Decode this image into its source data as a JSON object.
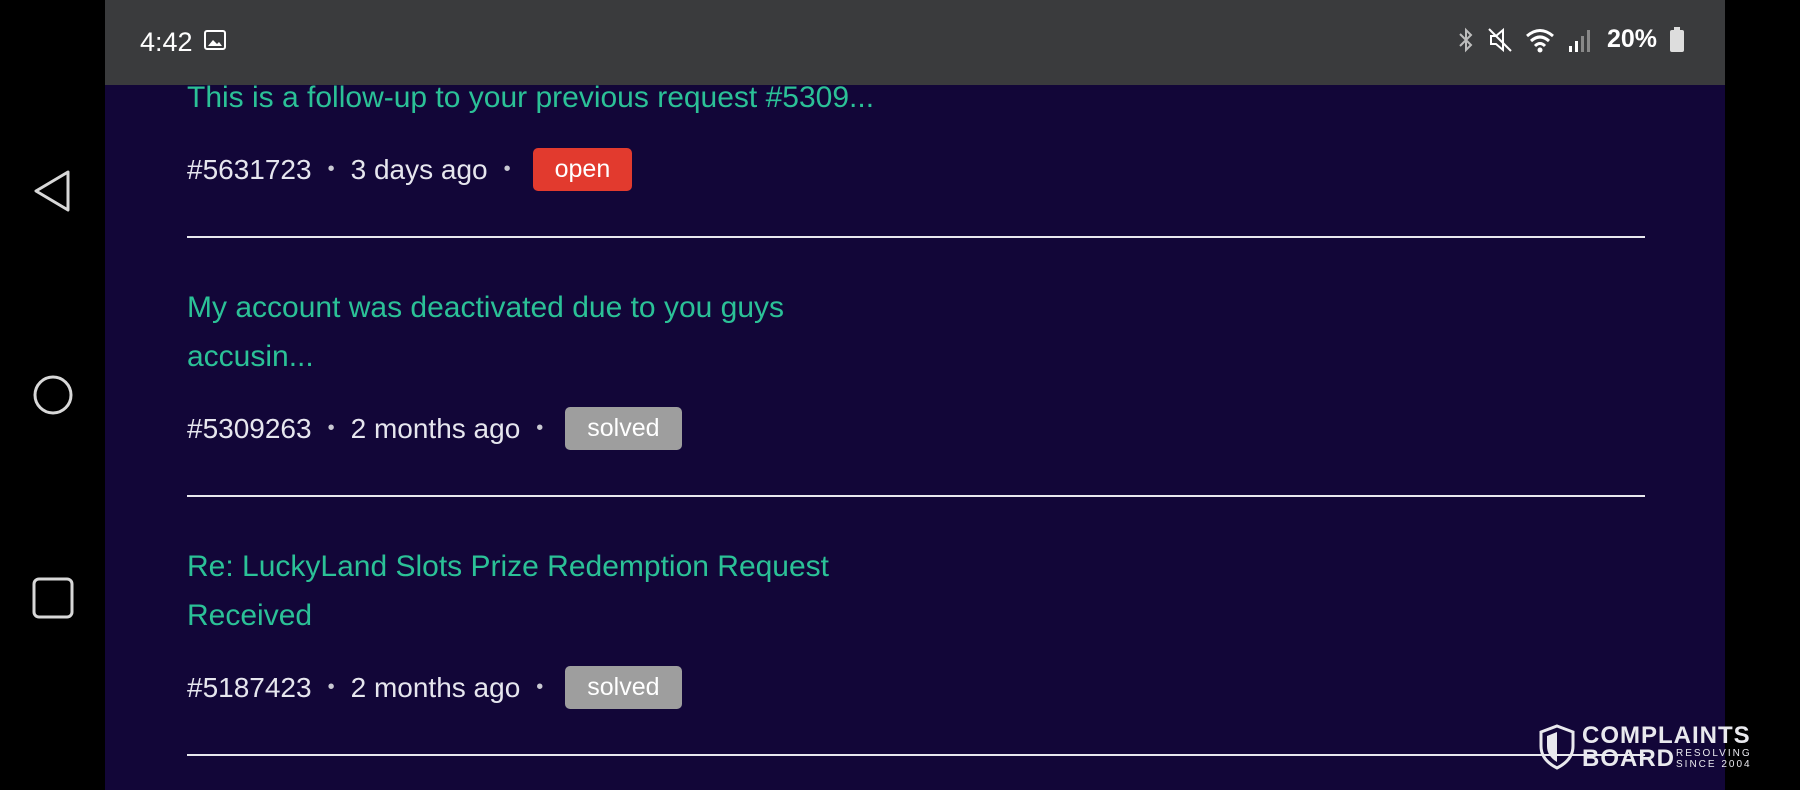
{
  "status_bar": {
    "time": "4:42",
    "battery": "20%"
  },
  "tickets": [
    {
      "title": "This is a follow-up to your previous request #5309...",
      "id": "#5631723",
      "time": "3 days ago",
      "status": "open",
      "status_color": "#e23a2e"
    },
    {
      "title_line1": "My account was deactivated due to you guys",
      "title_line2": "accusin...",
      "id": "#5309263",
      "time": "2 months ago",
      "status": "solved",
      "status_color": "#9e9e9e"
    },
    {
      "title_line1": "Re: LuckyLand Slots Prize Redemption Request",
      "title_line2": "Received",
      "id": "#5187423",
      "time": "2 months ago",
      "status": "solved",
      "status_color": "#9e9e9e"
    }
  ],
  "watermark": {
    "line1": "COMPLAINTS",
    "line2": "BOARD",
    "sub1": "RESOLVING",
    "sub2": "SINCE 2004"
  },
  "colors": {
    "background": "#120638",
    "link": "#2bc197",
    "status_bar": "#3a3b3d"
  },
  "icons": [
    "back-icon",
    "home-icon",
    "recents-icon",
    "gallery-icon",
    "bluetooth-icon",
    "mute-icon",
    "wifi-icon",
    "signal-icon",
    "battery-icon",
    "shield-icon"
  ]
}
